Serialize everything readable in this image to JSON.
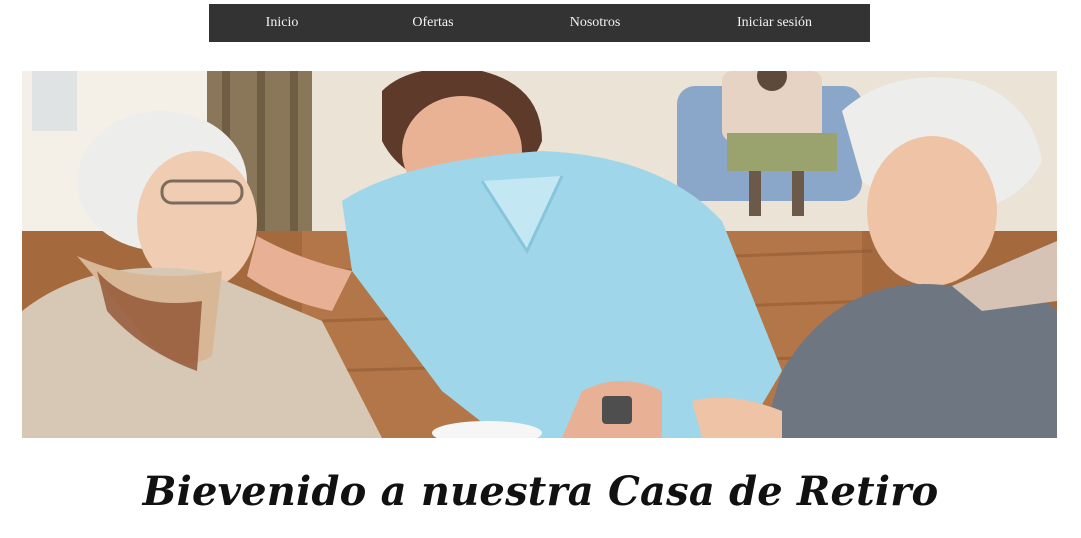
{
  "nav": {
    "items": [
      {
        "label": "Inicio"
      },
      {
        "label": "Ofertas"
      },
      {
        "label": "Nosotros"
      },
      {
        "label": "Iniciar sesión"
      }
    ]
  },
  "hero": {
    "image": "photo-caregiver-with-elderly-residents"
  },
  "welcome": {
    "title": "Bievenido a nuestra Casa de Retiro"
  },
  "colors": {
    "nav_background": "#333333",
    "nav_text": "#f2f2f2",
    "page_background": "#ffffff",
    "title_text": "#111111"
  }
}
